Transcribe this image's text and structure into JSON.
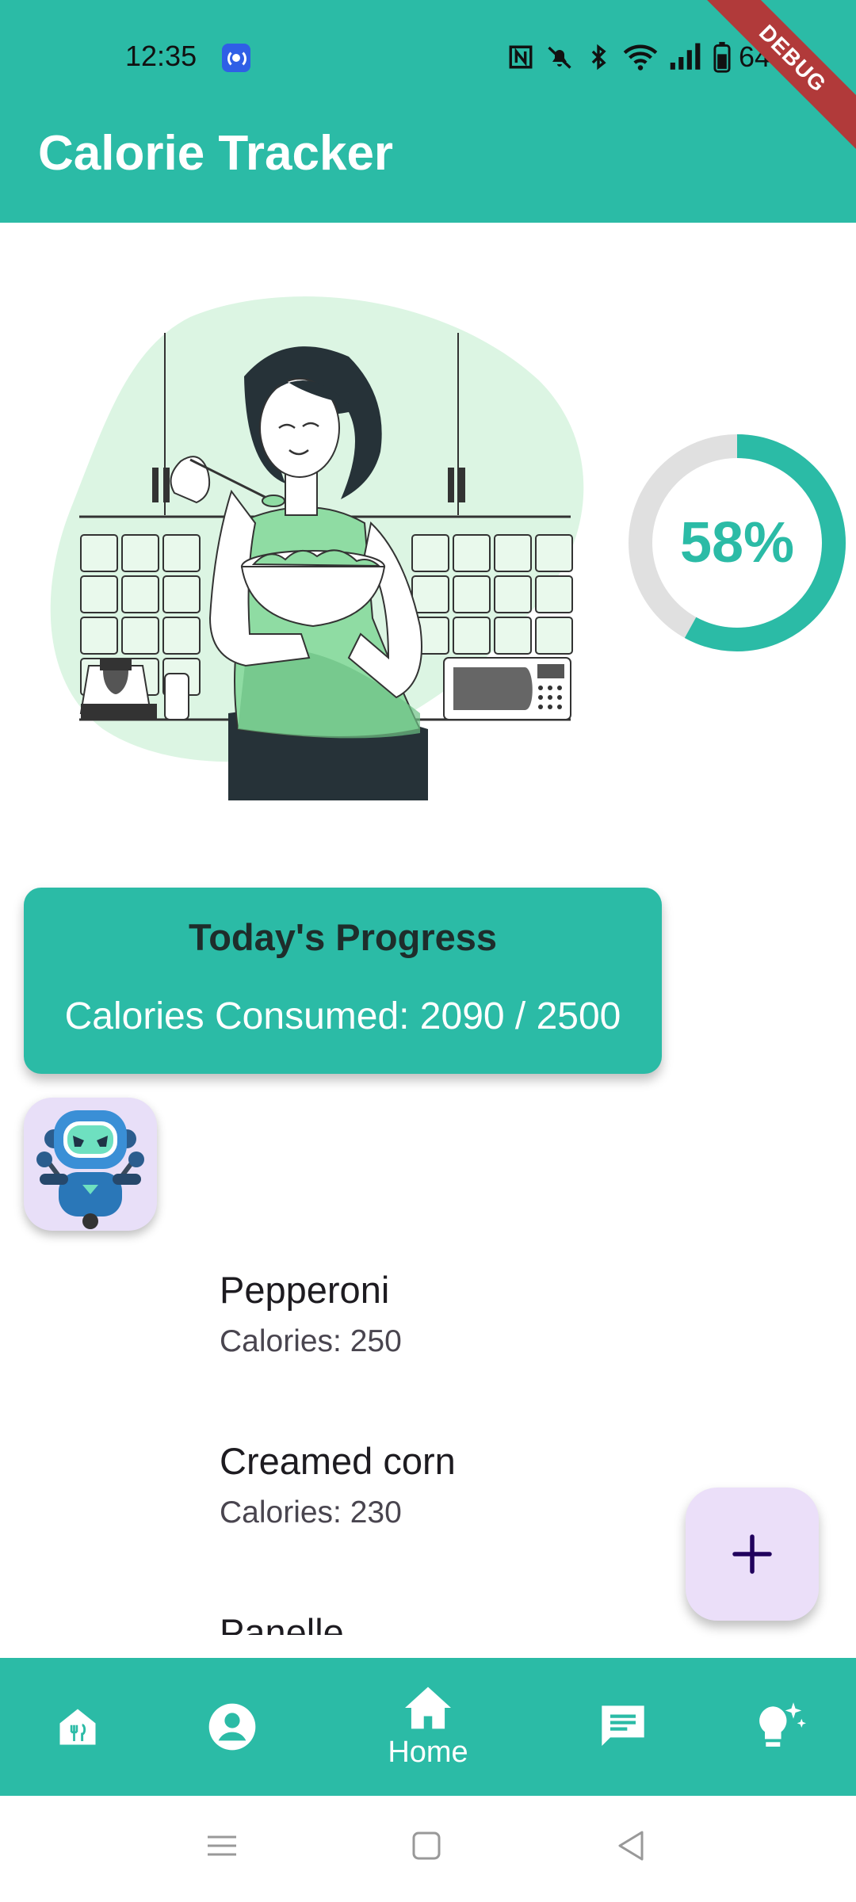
{
  "status_bar": {
    "time": "12:35",
    "battery": "64%",
    "debug_banner": "DEBUG"
  },
  "app_bar": {
    "title": "Calorie Tracker"
  },
  "progress_ring": {
    "percent_label": "58%",
    "percent": 58,
    "track_color": "#e0e0e0",
    "fill_color": "#2bbba6"
  },
  "progress_card": {
    "title": "Today's Progress",
    "calories_text": "Calories Consumed: 2090 / 2500"
  },
  "food_list": [
    {
      "name": "Pepperoni",
      "calories": "Calories: 250"
    },
    {
      "name": "Creamed corn",
      "calories": "Calories: 230"
    },
    {
      "name": "Panelle",
      "calories": ""
    }
  ],
  "bottom_nav": {
    "items": [
      {
        "icon": "restaurant-house-icon",
        "label": ""
      },
      {
        "icon": "account-circle-icon",
        "label": ""
      },
      {
        "icon": "home-icon",
        "label": "Home"
      },
      {
        "icon": "chat-icon",
        "label": ""
      },
      {
        "icon": "lightbulb-sparkle-icon",
        "label": ""
      }
    ]
  },
  "colors": {
    "primary": "#2bbba6",
    "illustration_accent": "#8fdca3",
    "fab_background": "#ebdff9",
    "fab_icon": "#21005d"
  }
}
